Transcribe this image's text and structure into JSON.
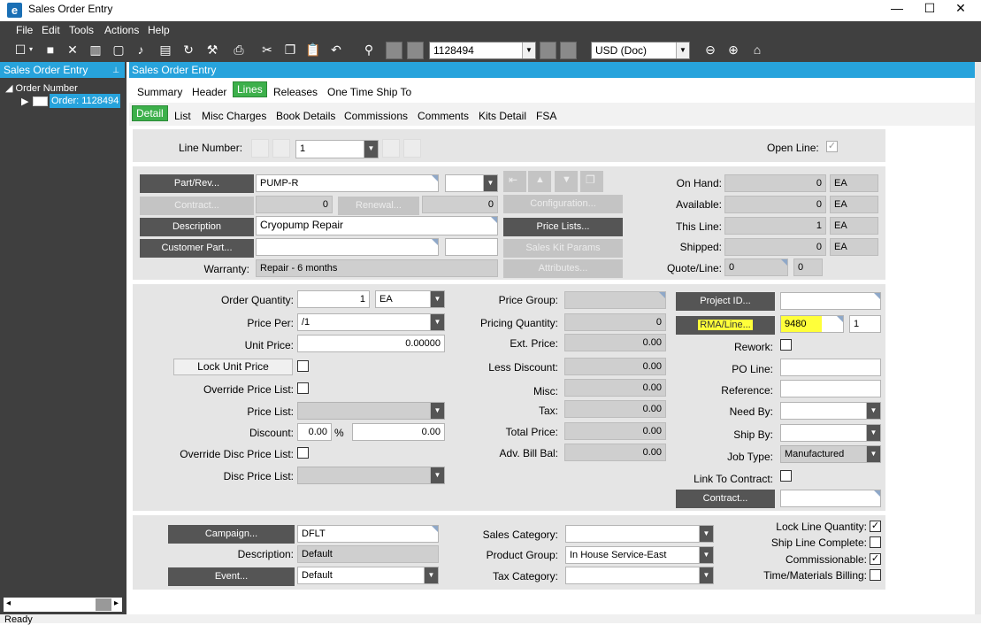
{
  "window": {
    "title": "Sales Order Entry",
    "minimize": "—",
    "maximize": "☐",
    "close": "✕"
  },
  "menu": [
    "File",
    "Edit",
    "Tools",
    "Actions",
    "Help"
  ],
  "toolbar": {
    "order_number": "1128494",
    "currency": "USD (Doc)"
  },
  "left_panel": {
    "header": "Sales Order Entry",
    "pin": "📌",
    "tree_root": "Order Number",
    "tree_child": "Order: 1128494"
  },
  "main_header": "Sales Order Entry",
  "top_tabs": [
    "Summary",
    "Header",
    "Lines",
    "Releases",
    "One Time Ship To"
  ],
  "sub_tabs": [
    "Detail",
    "List",
    "Misc Charges",
    "Book Details",
    "Commissions",
    "Comments",
    "Kits Detail",
    "FSA"
  ],
  "line": {
    "line_number_label": "Line Number:",
    "line_number": "1",
    "open_line_label": "Open Line:"
  },
  "part": {
    "part_rev_btn": "Part/Rev...",
    "part_num": "PUMP-R",
    "contract_btn": "Contract...",
    "contract_val": "0",
    "renewal_btn": "Renewal...",
    "renewal_val": "0",
    "description_btn": "Description",
    "description": "Cryopump Repair",
    "customer_part_btn": "Customer Part...",
    "warranty_label": "Warranty:",
    "warranty": "Repair - 6 months",
    "configuration_btn": "Configuration...",
    "price_lists_btn": "Price Lists...",
    "sales_kit_btn": "Sales Kit Params",
    "attributes_btn": "Attributes..."
  },
  "stock": {
    "on_hand_label": "On Hand:",
    "on_hand": "0",
    "on_hand_uom": "EA",
    "available_label": "Available:",
    "available": "0",
    "available_uom": "EA",
    "this_line_label": "This Line:",
    "this_line": "1",
    "this_line_uom": "EA",
    "shipped_label": "Shipped:",
    "shipped": "0",
    "shipped_uom": "EA",
    "quote_line_label": "Quote/Line:",
    "quote": "0",
    "quote_line": "0"
  },
  "pricing": {
    "order_qty_label": "Order Quantity:",
    "order_qty": "1",
    "order_qty_uom": "EA",
    "price_per_label": "Price Per:",
    "price_per": "/1",
    "unit_price_label": "Unit Price:",
    "unit_price": "0.00000",
    "lock_unit_price_btn": "Lock Unit Price",
    "override_price_list_label": "Override Price List:",
    "price_list_label": "Price List:",
    "discount_label": "Discount:",
    "discount_pct": "0.00",
    "pct_sign": "%",
    "discount_amt": "0.00",
    "override_disc_label": "Override Disc Price List:",
    "disc_price_list_label": "Disc Price List:"
  },
  "totals": {
    "price_group_label": "Price Group:",
    "pricing_qty_label": "Pricing Quantity:",
    "pricing_qty": "0",
    "ext_price_label": "Ext. Price:",
    "ext_price": "0.00",
    "less_discount_label": "Less Discount:",
    "less_discount": "0.00",
    "misc_label": "Misc:",
    "misc": "0.00",
    "tax_label": "Tax:",
    "tax": "0.00",
    "total_price_label": "Total Price:",
    "total_price": "0.00",
    "adv_bill_label": "Adv. Bill Bal:",
    "adv_bill": "0.00"
  },
  "project": {
    "project_id_btn": "Project ID...",
    "rma_btn": "RMA/Line...",
    "rma_num": "9480",
    "rma_line": "1",
    "rework_label": "Rework:",
    "po_line_label": "PO Line:",
    "reference_label": "Reference:",
    "need_by_label": "Need By:",
    "ship_by_label": "Ship By:",
    "job_type_label": "Job Type:",
    "job_type": "Manufactured",
    "link_contract_label": "Link To Contract:",
    "contract_btn": "Contract..."
  },
  "bottom": {
    "campaign_btn": "Campaign...",
    "campaign": "DFLT",
    "description_label": "Description:",
    "description": "Default",
    "event_btn": "Event...",
    "event": "Default",
    "sales_category_label": "Sales Category:",
    "product_group_label": "Product Group:",
    "product_group": "In House Service-East",
    "tax_category_label": "Tax Category:",
    "lock_line_qty_label": "Lock Line Quantity:",
    "ship_line_complete_label": "Ship Line Complete:",
    "commissionable_label": "Commissionable:",
    "time_materials_label": "Time/Materials Billing:"
  },
  "status_text": "Ready",
  "colors": {
    "accent_blue": "#27a3dc",
    "tab_green": "#3db04b",
    "dark": "#404040",
    "highlight": "#ffff3a"
  }
}
